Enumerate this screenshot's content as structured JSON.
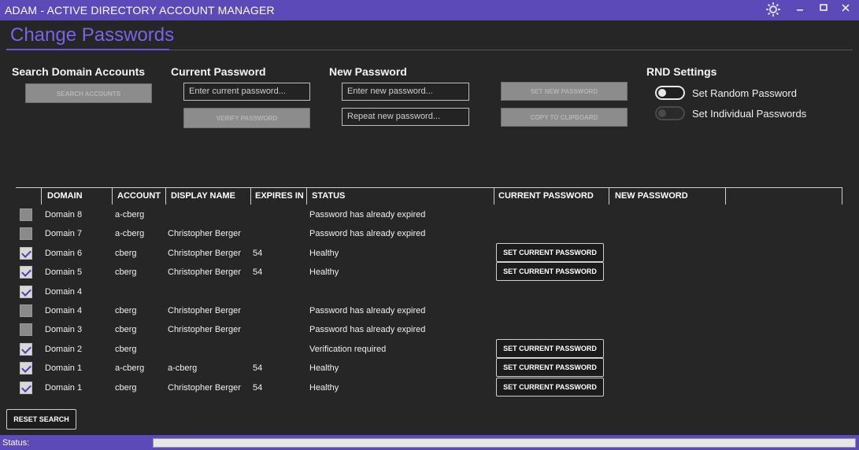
{
  "window": {
    "title": "ADAM - ACTIVE DIRECTORY ACCOUNT MANAGER"
  },
  "page": {
    "heading": "Change Passwords"
  },
  "search": {
    "title": "Search Domain Accounts",
    "search_button": "SEARCH ACCOUNTS"
  },
  "current_password": {
    "title": "Current Password",
    "placeholder": "Enter current password...",
    "verify_button": "VERIFY PASSWORD"
  },
  "new_password": {
    "title": "New Password",
    "placeholder": "Enter new password...",
    "repeat_placeholder": "Repeat new password..."
  },
  "actions": {
    "set_new_button": "SET NEW PASSWORD",
    "copy_button": "COPY TO CLIPBOARD"
  },
  "rnd": {
    "title": "RND Settings",
    "random_label": "Set Random Password",
    "individual_label": "Set Individual Passwords",
    "random_on": true,
    "individual_on": false
  },
  "table": {
    "headers": [
      "DOMAIN",
      "ACCOUNT",
      "DISPLAY NAME",
      "EXPIRES IN",
      "STATUS",
      "CURRENT PASSWORD",
      "NEW PASSWORD"
    ],
    "set_current_label": "SET CURRENT PASSWORD",
    "rows": [
      {
        "checked": false,
        "domain": "Domain 8",
        "account": "a-cberg",
        "display": "",
        "expires": "",
        "status": "Password has already expired",
        "btn": false
      },
      {
        "checked": false,
        "domain": "Domain 7",
        "account": "a-cberg",
        "display": "Christopher Berger",
        "expires": "",
        "status": "Password has already expired",
        "btn": false
      },
      {
        "checked": true,
        "domain": "Domain 6",
        "account": "cberg",
        "display": "Christopher Berger",
        "expires": "54",
        "status": "Healthy",
        "btn": true
      },
      {
        "checked": true,
        "domain": "Domain 5",
        "account": "cberg",
        "display": "Christopher Berger",
        "expires": "54",
        "status": "Healthy",
        "btn": true
      },
      {
        "checked": true,
        "domain": "Domain 4",
        "account": "",
        "display": "",
        "expires": "",
        "status": "",
        "btn": false
      },
      {
        "checked": false,
        "domain": "Domain 4",
        "account": "cberg",
        "display": "Christopher Berger",
        "expires": "",
        "status": "Password has already expired",
        "btn": false
      },
      {
        "checked": false,
        "domain": "Domain 3",
        "account": "cberg",
        "display": "Christopher Berger",
        "expires": "",
        "status": "Password has already expired",
        "btn": false
      },
      {
        "checked": true,
        "domain": "Domain 2",
        "account": "cberg",
        "display": "",
        "expires": "",
        "status": "Verification required",
        "btn": true
      },
      {
        "checked": true,
        "domain": "Domain 1",
        "account": "a-cberg",
        "display": "a-cberg",
        "expires": "54",
        "status": "Healthy",
        "btn": true
      },
      {
        "checked": true,
        "domain": "Domain 1",
        "account": "cberg",
        "display": "Christopher Berger",
        "expires": "54",
        "status": "Healthy",
        "btn": true
      }
    ]
  },
  "footer": {
    "reset_button": "RESET SEARCH",
    "status_label": "Status:"
  },
  "colors": {
    "accent": "#5b4ab8",
    "heading": "#7a63e8",
    "background": "#262626"
  }
}
